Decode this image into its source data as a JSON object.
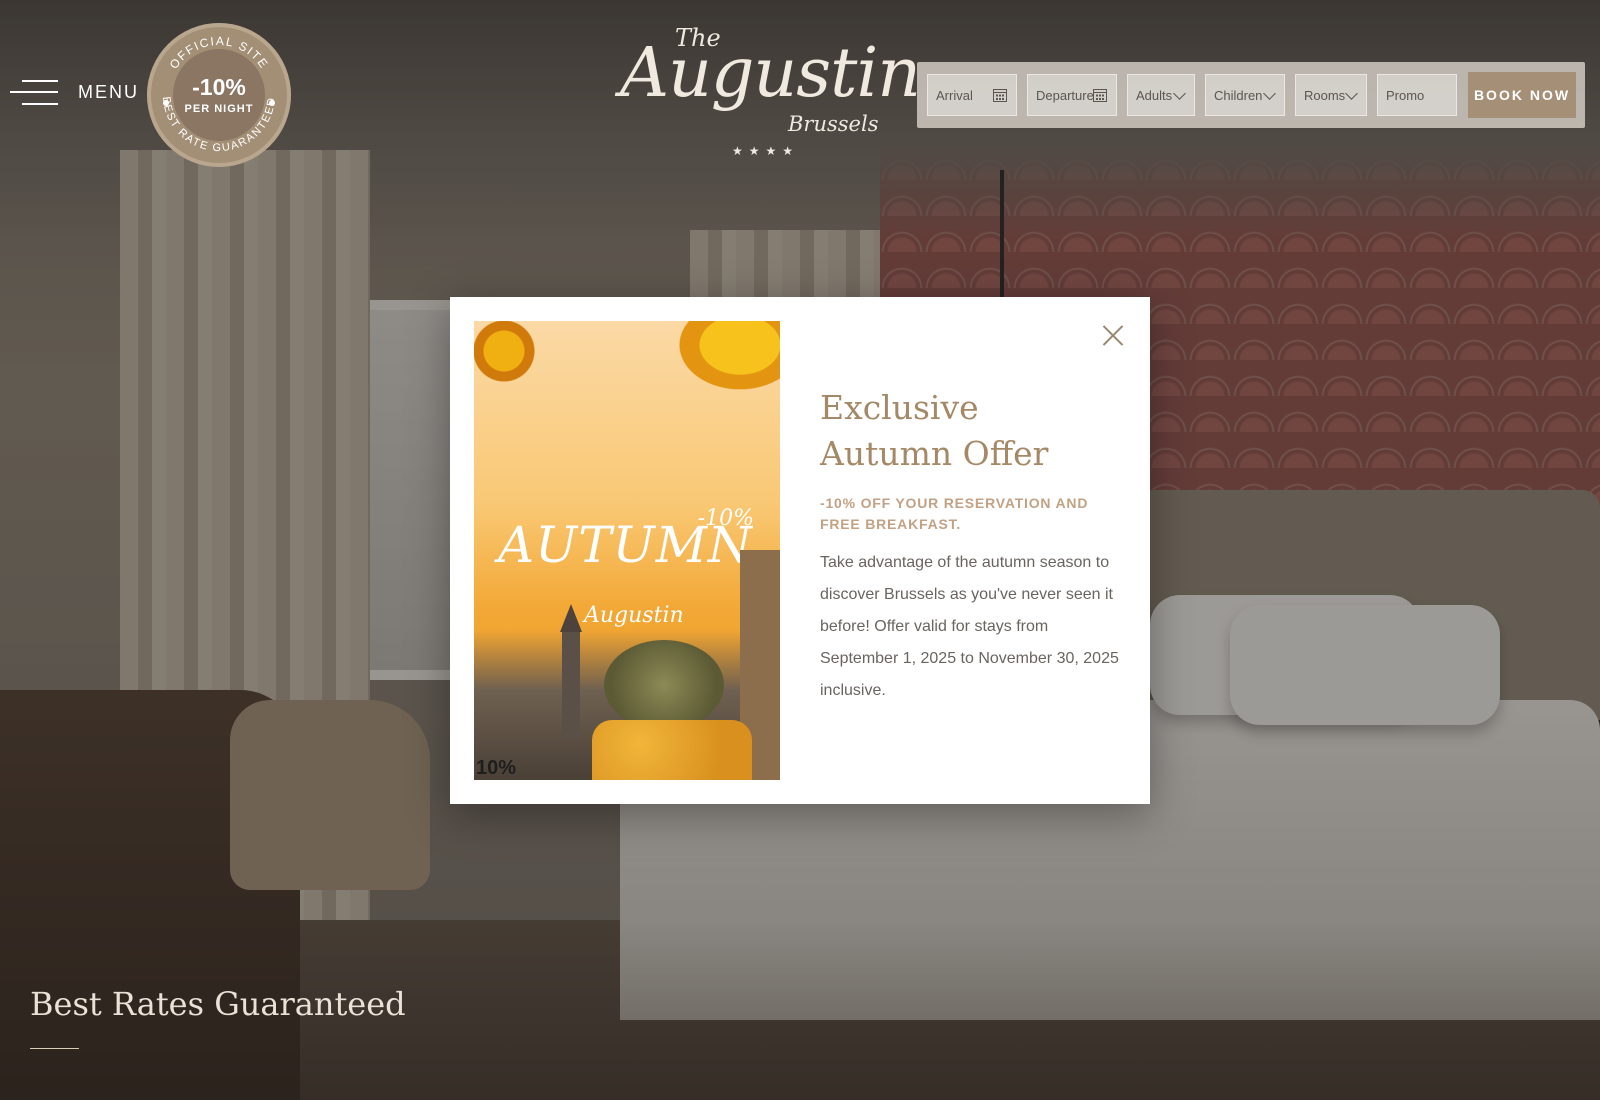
{
  "header": {
    "menu_label": "MENU",
    "badge": {
      "arc_top": "OFFICIAL SITE",
      "discount": "-10%",
      "per_night": "PER NIGHT",
      "arc_bottom": "BEST RATE GUARANTEED"
    },
    "logo": {
      "the": "The",
      "name": "Augustin",
      "city": "Brussels",
      "stars": "★★★★"
    }
  },
  "booking": {
    "arrival_placeholder": "Arrival",
    "departure_placeholder": "Departure",
    "adults": "Adults",
    "children": "Children",
    "rooms": "Rooms",
    "promo_placeholder": "Promo",
    "book_now": "BOOK NOW"
  },
  "hero": {
    "caption": "Best Rates Guaranteed"
  },
  "modal": {
    "promo_image": {
      "discount": "-10%",
      "title": "AUTUMN",
      "mini_logo": "Augustin",
      "corner": "10%"
    },
    "title": "Exclusive Autumn Offer",
    "subtitle": "-10% OFF YOUR RESERVATION AND FREE BREAKFAST.",
    "body": "Take advantage of the autumn season to discover Brussels as you've never seen it before! Offer valid for stays from September 1, 2025 to November 30, 2025 inclusive."
  },
  "colors": {
    "accent": "#a58f76",
    "title": "#a58866",
    "subtitle": "#c2a184"
  }
}
